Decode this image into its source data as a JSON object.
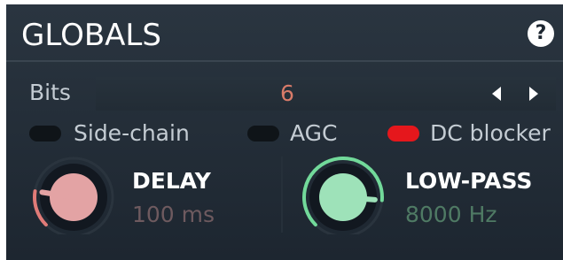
{
  "header": {
    "title": "GLOBALS",
    "help_icon": "?"
  },
  "bits": {
    "label": "Bits",
    "value": "6"
  },
  "toggles": [
    {
      "label": "Side-chain",
      "on": false
    },
    {
      "label": "AGC",
      "on": false
    },
    {
      "label": "DC blocker",
      "on": true
    }
  ],
  "knobs": [
    {
      "title": "DELAY",
      "value": "100 ms",
      "accent": "#e07b78",
      "level": 0.2,
      "value_color": "#6e5a5f"
    },
    {
      "title": "LOW-PASS",
      "value": "8000 Hz",
      "accent": "#72d99a",
      "level": 0.85,
      "value_color": "#4f7a64"
    }
  ]
}
